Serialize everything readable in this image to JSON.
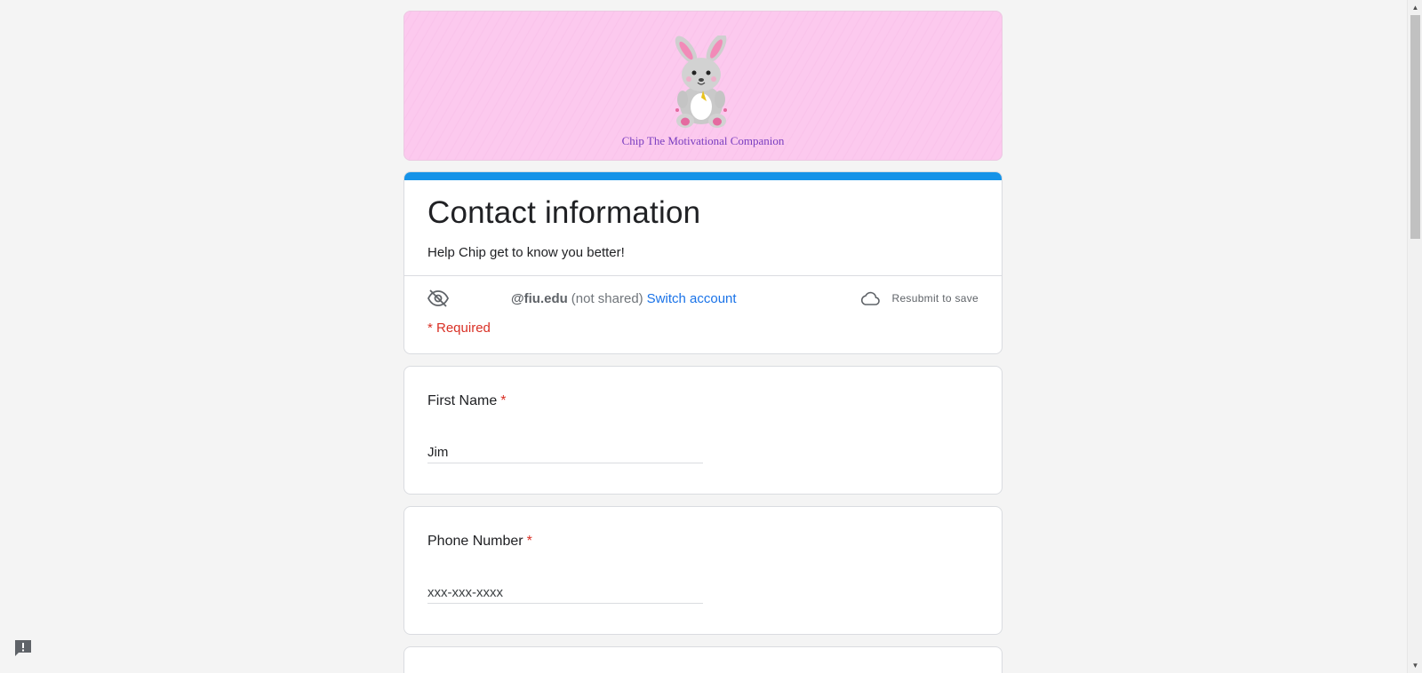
{
  "banner": {
    "caption": "Chip The Motivational Companion",
    "image_icon": "bunny-mascot-icon"
  },
  "form": {
    "title": "Contact information",
    "description": "Help Chip get to know you better!",
    "account": {
      "icon": "eye-off-icon",
      "email": "@fiu.edu",
      "not_shared": "(not shared)",
      "switch_label": "Switch account"
    },
    "save_status": {
      "icon": "cloud-icon",
      "label": "Resubmit to save"
    },
    "required_note": "* Required"
  },
  "questions": [
    {
      "title": "First Name",
      "required_mark": "*",
      "value": "Jim",
      "placeholder": ""
    },
    {
      "title": "Phone Number",
      "required_mark": "*",
      "value": "",
      "placeholder": "xxx-xxx-xxxx"
    }
  ],
  "feedback": {
    "icon": "report-feedback-icon"
  },
  "colors": {
    "accent": "#1693e8",
    "banner_bg": "#fcc9ee",
    "required": "#d93025",
    "link": "#1a73e8",
    "background": "#f4f4f4"
  }
}
